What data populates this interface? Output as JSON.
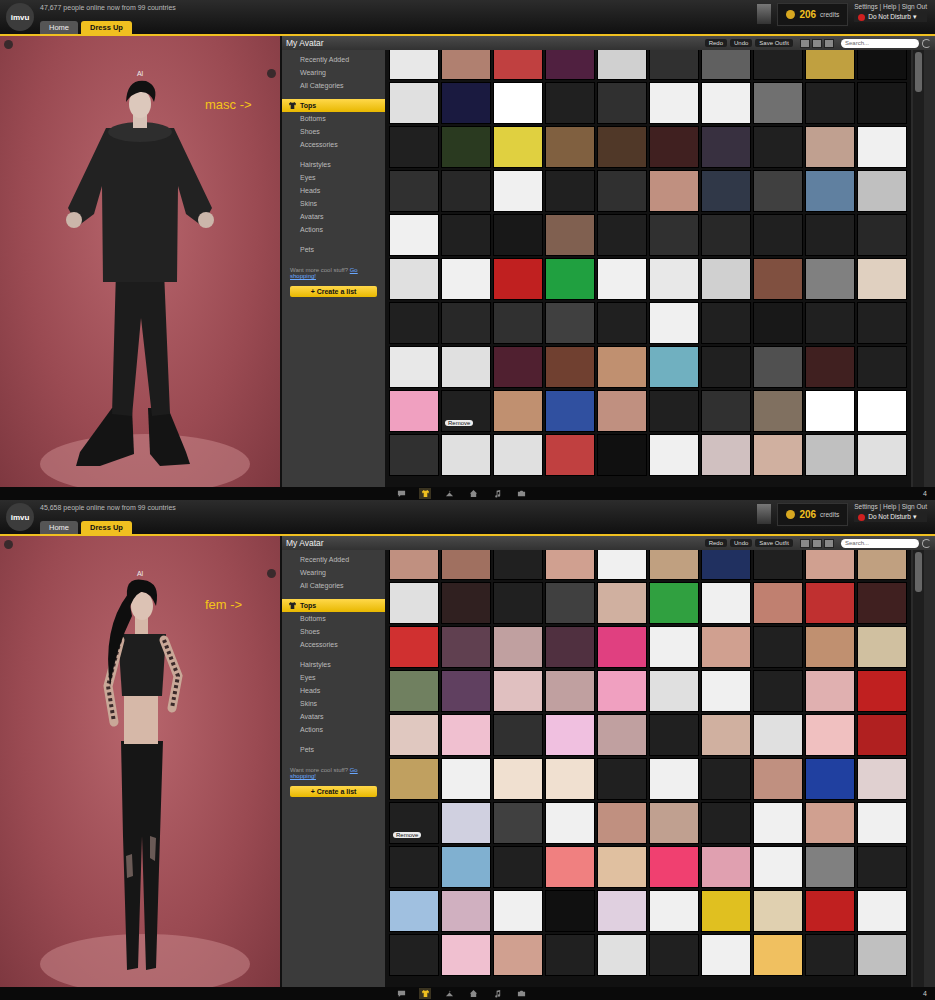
{
  "screens": [
    {
      "logo": "imvu",
      "online": "47,677 people online now from 99 countries",
      "tabs": [
        {
          "label": "Home",
          "selected": false
        },
        {
          "label": "Dress Up",
          "selected": true
        }
      ],
      "credits": "206",
      "credits_label": "credits",
      "account_links": "Settings | Help | Sign Out",
      "status": "Do Not Disturb ▾",
      "avatar_name": "Al",
      "avatar_kind": "masc",
      "annotation": "masc ->",
      "panel_title": "My Avatar",
      "toolbar_buttons": [
        "Redo",
        "Undo",
        "Save Outfit"
      ],
      "search_placeholder": "Search...",
      "category_groups": [
        [
          {
            "label": "Recently Added",
            "selected": false
          },
          {
            "label": "Wearing",
            "selected": false
          },
          {
            "label": "All Categories",
            "selected": false
          }
        ],
        [
          {
            "label": "Tops",
            "selected": true
          },
          {
            "label": "Bottoms",
            "selected": false
          },
          {
            "label": "Shoes",
            "selected": false
          },
          {
            "label": "Accessories",
            "selected": false
          }
        ],
        [
          {
            "label": "Hairstyles",
            "selected": false
          },
          {
            "label": "Eyes",
            "selected": false
          },
          {
            "label": "Heads",
            "selected": false
          },
          {
            "label": "Skins",
            "selected": false
          },
          {
            "label": "Avatars",
            "selected": false
          },
          {
            "label": "Actions",
            "selected": false
          }
        ],
        [
          {
            "label": "Pets",
            "selected": false
          }
        ]
      ],
      "shop_prompt": "Want more cool stuff?",
      "shop_link": "Go shopping!",
      "create_list": "+ Create a list",
      "dock": [
        {
          "selected": false
        },
        {
          "selected": true
        },
        {
          "selected": false
        },
        {
          "selected": false
        },
        {
          "selected": false
        },
        {
          "selected": false
        }
      ],
      "dock_count": "4",
      "items": [
        {
          "color": "#e8e8e8"
        },
        {
          "color": "#b08070"
        },
        {
          "color": "#c04040"
        },
        {
          "color": "#502040"
        },
        {
          "color": "#d0d0d0"
        },
        {
          "color": "#303030"
        },
        {
          "color": "#606060"
        },
        {
          "color": "#202020"
        },
        {
          "color": "#c0a040"
        },
        {
          "color": "#101010"
        },
        {
          "color": "#e0e0e0"
        },
        {
          "color": "#1a1a40"
        },
        {
          "color": "#ffffff"
        },
        {
          "color": "#202020"
        },
        {
          "color": "#303030"
        },
        {
          "color": "#f0f0f0"
        },
        {
          "color": "#f0f0f0"
        },
        {
          "color": "#707070"
        },
        {
          "color": "#202020"
        },
        {
          "color": "#181818"
        },
        {
          "color": "#202020"
        },
        {
          "color": "#2a3a20"
        },
        {
          "color": "#e0d040"
        },
        {
          "color": "#806040"
        },
        {
          "color": "#503828"
        },
        {
          "color": "#402020"
        },
        {
          "color": "#383040"
        },
        {
          "color": "#202020"
        },
        {
          "color": "#c0a090"
        },
        {
          "color": "#f0f0f0"
        },
        {
          "color": "#303030"
        },
        {
          "color": "#282828"
        },
        {
          "color": "#f0f0f0"
        },
        {
          "color": "#202020"
        },
        {
          "color": "#303030"
        },
        {
          "color": "#c09080"
        },
        {
          "color": "#303848"
        },
        {
          "color": "#404040"
        },
        {
          "color": "#6080a0"
        },
        {
          "color": "#c0c0c0"
        },
        {
          "color": "#f0f0f0"
        },
        {
          "color": "#202020"
        },
        {
          "color": "#181818"
        },
        {
          "color": "#806050"
        },
        {
          "color": "#202020"
        },
        {
          "color": "#303030"
        },
        {
          "color": "#282828"
        },
        {
          "color": "#202020"
        },
        {
          "color": "#202020"
        },
        {
          "color": "#282828"
        },
        {
          "color": "#e0e0e0"
        },
        {
          "color": "#f0f0f0"
        },
        {
          "color": "#c02020"
        },
        {
          "color": "#20a040"
        },
        {
          "color": "#f0f0f0"
        },
        {
          "color": "#e8e8e8"
        },
        {
          "color": "#d0d0d0"
        },
        {
          "color": "#805040"
        },
        {
          "color": "#808080"
        },
        {
          "color": "#e0d0c0"
        },
        {
          "color": "#202020"
        },
        {
          "color": "#282828"
        },
        {
          "color": "#303030"
        },
        {
          "color": "#404040"
        },
        {
          "color": "#202020"
        },
        {
          "color": "#f0f0f0"
        },
        {
          "color": "#202020"
        },
        {
          "color": "#181818"
        },
        {
          "color": "#202020"
        },
        {
          "color": "#202020"
        },
        {
          "color": "#e8e8e8"
        },
        {
          "color": "#e0e0e0"
        },
        {
          "color": "#502030"
        },
        {
          "color": "#704030"
        },
        {
          "color": "#c09070"
        },
        {
          "color": "#70b0c0"
        },
        {
          "color": "#202020"
        },
        {
          "color": "#505050"
        },
        {
          "color": "#402020"
        },
        {
          "color": "#202020"
        },
        {
          "color": "#f0a0c0"
        },
        {
          "color": "#202020",
          "button": "Remove"
        },
        {
          "color": "#c09070"
        },
        {
          "color": "#3050a0"
        },
        {
          "color": "#c09080"
        },
        {
          "color": "#202020"
        },
        {
          "color": "#303030"
        },
        {
          "color": "#807060"
        },
        {
          "color": "#ffffff"
        },
        {
          "color": "#ffffff"
        },
        {
          "color": "#303030"
        },
        {
          "color": "#e0e0e0"
        },
        {
          "color": "#e0e0e0"
        },
        {
          "color": "#c04040"
        },
        {
          "color": "#101010"
        },
        {
          "color": "#f0f0f0"
        },
        {
          "color": "#d0c0c0"
        },
        {
          "color": "#d0b0a0"
        },
        {
          "color": "#c0c0c0"
        },
        {
          "color": "#e0e0e0"
        }
      ]
    },
    {
      "logo": "imvu",
      "online": "45,658 people online now from 99 countries",
      "tabs": [
        {
          "label": "Home",
          "selected": false
        },
        {
          "label": "Dress Up",
          "selected": true
        }
      ],
      "credits": "206",
      "credits_label": "credits",
      "account_links": "Settings | Help | Sign Out",
      "status": "Do Not Disturb ▾",
      "avatar_name": "Al",
      "avatar_kind": "fem",
      "annotation": "fem ->",
      "panel_title": "My Avatar",
      "toolbar_buttons": [
        "Redo",
        "Undo",
        "Save Outfit"
      ],
      "search_placeholder": "Search...",
      "category_groups": [
        [
          {
            "label": "Recently Added",
            "selected": false
          },
          {
            "label": "Wearing",
            "selected": false
          },
          {
            "label": "All Categories",
            "selected": false
          }
        ],
        [
          {
            "label": "Tops",
            "selected": true
          },
          {
            "label": "Bottoms",
            "selected": false
          },
          {
            "label": "Shoes",
            "selected": false
          },
          {
            "label": "Accessories",
            "selected": false
          }
        ],
        [
          {
            "label": "Hairstyles",
            "selected": false
          },
          {
            "label": "Eyes",
            "selected": false
          },
          {
            "label": "Heads",
            "selected": false
          },
          {
            "label": "Skins",
            "selected": false
          },
          {
            "label": "Avatars",
            "selected": false
          },
          {
            "label": "Actions",
            "selected": false
          }
        ],
        [
          {
            "label": "Pets",
            "selected": false
          }
        ]
      ],
      "shop_prompt": "Want more cool stuff?",
      "shop_link": "Go shopping!",
      "create_list": "+ Create a list",
      "dock": [
        {
          "selected": false
        },
        {
          "selected": true
        },
        {
          "selected": false
        },
        {
          "selected": false
        },
        {
          "selected": false
        },
        {
          "selected": false
        }
      ],
      "dock_count": "4",
      "items": [
        {
          "color": "#c09080"
        },
        {
          "color": "#a07060"
        },
        {
          "color": "#202020"
        },
        {
          "color": "#d0a090"
        },
        {
          "color": "#f0f0f0"
        },
        {
          "color": "#c0a080"
        },
        {
          "color": "#203060"
        },
        {
          "color": "#202020"
        },
        {
          "color": "#d0a090"
        },
        {
          "color": "#c0a080"
        },
        {
          "color": "#e0e0e0"
        },
        {
          "color": "#302020"
        },
        {
          "color": "#202020"
        },
        {
          "color": "#404040"
        },
        {
          "color": "#d0b0a0"
        },
        {
          "color": "#30a040"
        },
        {
          "color": "#f0f0f0"
        },
        {
          "color": "#c08070"
        },
        {
          "color": "#c03030"
        },
        {
          "color": "#402020"
        },
        {
          "color": "#d03030"
        },
        {
          "color": "#604050"
        },
        {
          "color": "#c0a0a0"
        },
        {
          "color": "#503040"
        },
        {
          "color": "#e04080"
        },
        {
          "color": "#f0f0f0"
        },
        {
          "color": "#d0a090"
        },
        {
          "color": "#202020"
        },
        {
          "color": "#c09070"
        },
        {
          "color": "#d0c0a0"
        },
        {
          "color": "#708060"
        },
        {
          "color": "#604060"
        },
        {
          "color": "#e0c0c0"
        },
        {
          "color": "#c0a0a0"
        },
        {
          "color": "#f0a0c0"
        },
        {
          "color": "#e0e0e0"
        },
        {
          "color": "#f0f0f0"
        },
        {
          "color": "#202020"
        },
        {
          "color": "#e0b0b0"
        },
        {
          "color": "#c02020"
        },
        {
          "color": "#e0c8c0"
        },
        {
          "color": "#f0c0d0"
        },
        {
          "color": "#303030"
        },
        {
          "color": "#f0c0e0"
        },
        {
          "color": "#c0a0a0"
        },
        {
          "color": "#202020"
        },
        {
          "color": "#d0b0a0"
        },
        {
          "color": "#e0e0e0"
        },
        {
          "color": "#f0c0c0"
        },
        {
          "color": "#b02020"
        },
        {
          "color": "#c0a060"
        },
        {
          "color": "#f0f0f0"
        },
        {
          "color": "#f0e0d0"
        },
        {
          "color": "#f0e0d0"
        },
        {
          "color": "#202020"
        },
        {
          "color": "#f0f0f0"
        },
        {
          "color": "#202020"
        },
        {
          "color": "#c09080"
        },
        {
          "color": "#2040a0"
        },
        {
          "color": "#e0d0d0"
        },
        {
          "color": "#202020",
          "button": "Remove"
        },
        {
          "color": "#d0d0e0"
        },
        {
          "color": "#404040"
        },
        {
          "color": "#f0f0f0"
        },
        {
          "color": "#c09080"
        },
        {
          "color": "#c0a090"
        },
        {
          "color": "#202020"
        },
        {
          "color": "#f0f0f0"
        },
        {
          "color": "#d0a090"
        },
        {
          "color": "#f0f0f0"
        },
        {
          "color": "#202020"
        },
        {
          "color": "#80b0d0"
        },
        {
          "color": "#202020"
        },
        {
          "color": "#f08080"
        },
        {
          "color": "#e0c0a0"
        },
        {
          "color": "#f04070"
        },
        {
          "color": "#e0a0b0"
        },
        {
          "color": "#f0f0f0"
        },
        {
          "color": "#808080"
        },
        {
          "color": "#202020"
        },
        {
          "color": "#a0c0e0"
        },
        {
          "color": "#d0b0c0"
        },
        {
          "color": "#f0f0f0"
        },
        {
          "color": "#101010"
        },
        {
          "color": "#e0d0e0"
        },
        {
          "color": "#f0f0f0"
        },
        {
          "color": "#e0c020"
        },
        {
          "color": "#e0d0b0"
        },
        {
          "color": "#c02020"
        },
        {
          "color": "#f0f0f0"
        },
        {
          "color": "#202020"
        },
        {
          "color": "#f0c0d0"
        },
        {
          "color": "#d0a090"
        },
        {
          "color": "#202020"
        },
        {
          "color": "#e0e0e0"
        },
        {
          "color": "#202020"
        },
        {
          "color": "#f0f0f0"
        },
        {
          "color": "#f0c060"
        },
        {
          "color": "#202020"
        },
        {
          "color": "#c0c0c0"
        }
      ]
    }
  ]
}
